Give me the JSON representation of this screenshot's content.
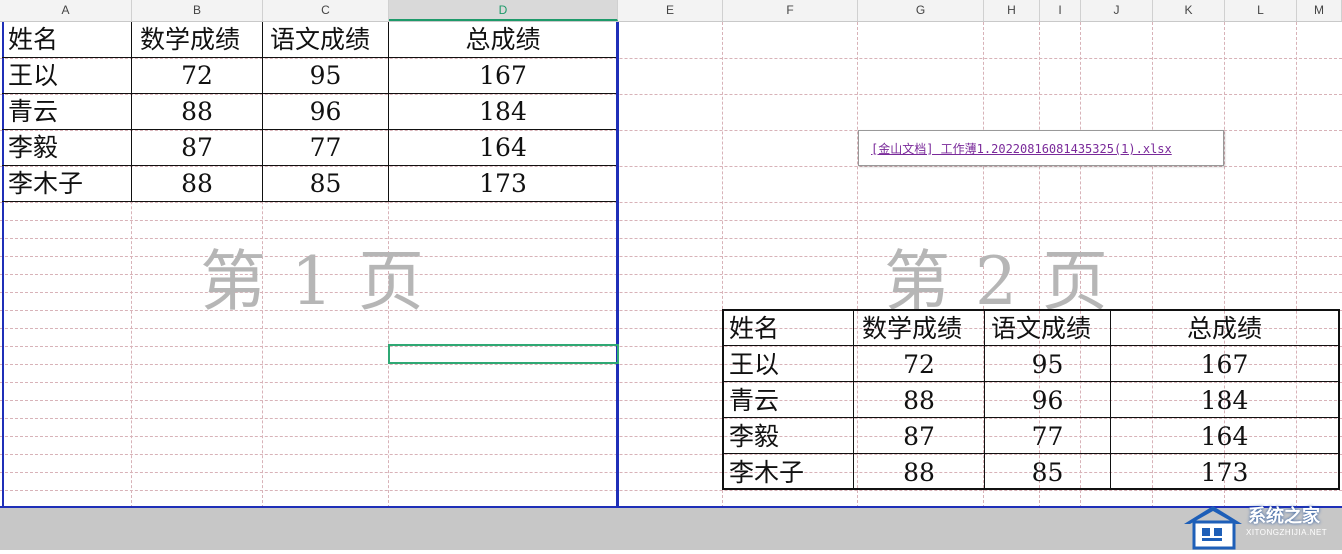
{
  "columns": [
    "A",
    "B",
    "C",
    "D",
    "E",
    "F",
    "G",
    "H",
    "I",
    "J",
    "K",
    "L",
    "M"
  ],
  "selected_column": "D",
  "table1": {
    "headers": [
      "姓名",
      "数学成绩",
      "语文成绩",
      "总成绩"
    ],
    "rows": [
      [
        "王以",
        "72",
        "95",
        "167"
      ],
      [
        "青云",
        "88",
        "96",
        "184"
      ],
      [
        "李毅",
        "87",
        "77",
        "164"
      ],
      [
        "李木子",
        "88",
        "85",
        "173"
      ]
    ]
  },
  "table2": {
    "headers": [
      "姓名",
      "数学成绩",
      "语文成绩",
      "总成绩"
    ],
    "rows": [
      [
        "王以",
        "72",
        "95",
        "167"
      ],
      [
        "青云",
        "88",
        "96",
        "184"
      ],
      [
        "李毅",
        "87",
        "77",
        "164"
      ],
      [
        "李木子",
        "88",
        "85",
        "173"
      ]
    ]
  },
  "watermark1": "第 1 页",
  "watermark2": "第 2 页",
  "link_text": "[金山文档] 工作薄1.20220816081435325(1).xlsx",
  "logo": {
    "name": "系统之家",
    "sub": "XITONGZHIJIA.NET"
  },
  "colors": {
    "page_break": "#1f2fb8",
    "selection": "#2fa874",
    "link": "#7a2a9a",
    "watermark": "#b6b6b6"
  }
}
